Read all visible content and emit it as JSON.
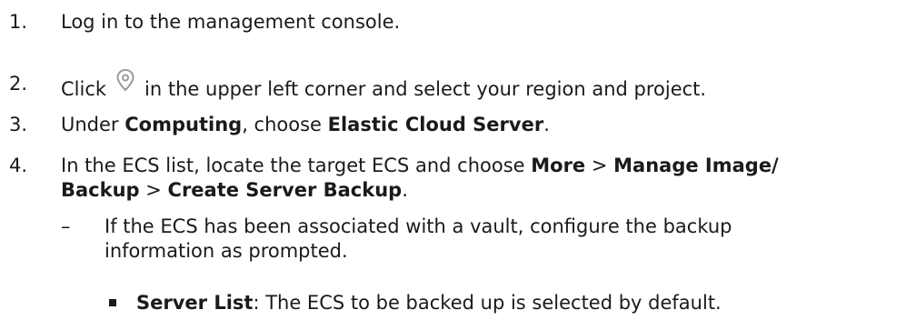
{
  "steps": [
    {
      "number": "1.",
      "text": "Log in to the management console."
    },
    {
      "number": "2.",
      "before_icon": "Click",
      "icon": "location-pin-icon",
      "after_icon": "in the upper left corner and select your region and project."
    },
    {
      "number": "3.",
      "t1": "Under ",
      "b1": "Computing",
      "t2": ", choose ",
      "b2": "Elastic Cloud Server",
      "t3": "."
    },
    {
      "number": "4.",
      "t1": "In the ECS list, locate the target ECS and choose ",
      "b1": "More",
      "t2": " > ",
      "b2": "Manage Image/",
      "b3": "Backup",
      "t3": " > ",
      "b4": "Create Server Backup",
      "t4": "."
    }
  ],
  "sub_item": {
    "marker": "–",
    "line1": "If the ECS has been associated with a vault, configure the backup",
    "line2": "information as prompted."
  },
  "sub_sub_item": {
    "bold": "Server List",
    "text": ": The ECS to be backed up is selected by default."
  },
  "colors": {
    "text": "#1a1a1a",
    "icon": "#9a9a9a"
  }
}
